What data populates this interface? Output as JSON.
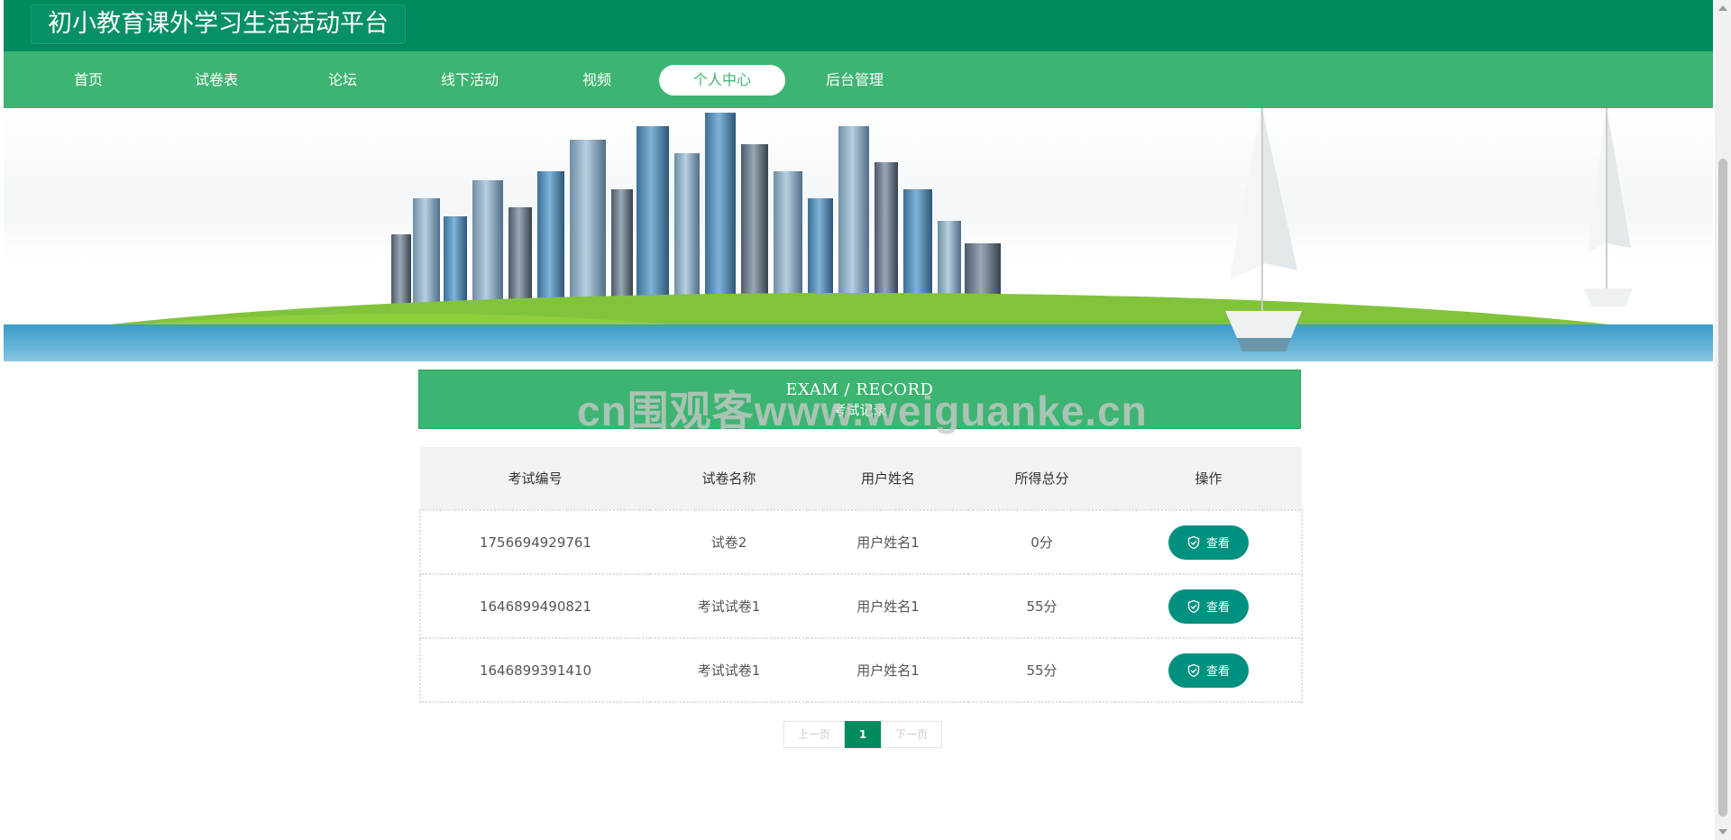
{
  "site": {
    "title": "初小教育课外学习生活活动平台"
  },
  "nav": {
    "items": [
      {
        "label": "首页"
      },
      {
        "label": "试卷表"
      },
      {
        "label": "论坛"
      },
      {
        "label": "线下活动"
      },
      {
        "label": "视频"
      },
      {
        "label": "个人中心",
        "active": true
      },
      {
        "label": "后台管理"
      }
    ]
  },
  "banner": {
    "slide_count": 3,
    "active_slide": 1
  },
  "section": {
    "title_en": "EXAM / RECORD",
    "title_cn": "考试记录"
  },
  "watermark": "cn围观客www.weiguanke.cn",
  "table": {
    "headers": [
      "考试编号",
      "试卷名称",
      "用户姓名",
      "所得总分",
      "操作"
    ],
    "rows": [
      {
        "id": "1756694929761",
        "paper": "试卷2",
        "user": "用户姓名1",
        "score": "0分",
        "action": "查看"
      },
      {
        "id": "1646899490821",
        "paper": "考试试卷1",
        "user": "用户姓名1",
        "score": "55分",
        "action": "查看"
      },
      {
        "id": "1646899391410",
        "paper": "考试试卷1",
        "user": "用户姓名1",
        "score": "55分",
        "action": "查看"
      }
    ]
  },
  "pagination": {
    "prev": "上一页",
    "current": "1",
    "next": "下一页"
  },
  "colors": {
    "header": "#008a60",
    "nav": "#3db471",
    "button": "#009080"
  },
  "icons": {
    "view_button": "shield-check-icon"
  }
}
